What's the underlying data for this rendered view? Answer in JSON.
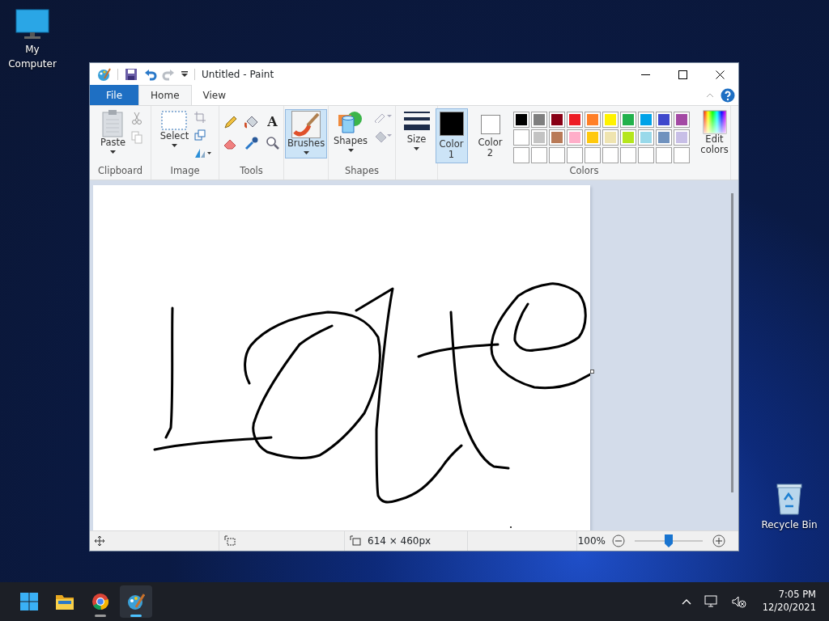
{
  "desktop_icons": [
    {
      "label": "My Computer",
      "kind": "computer"
    },
    {
      "label": "Recycle Bin",
      "kind": "bin"
    }
  ],
  "window": {
    "title": "Untitled - Paint"
  },
  "ribbon_tabs": [
    {
      "label": "File",
      "kind": "file",
      "selected": false
    },
    {
      "label": "Home",
      "kind": "tab",
      "selected": true
    },
    {
      "label": "View",
      "kind": "tab",
      "selected": false
    }
  ],
  "clipboard": {
    "paste": "Paste",
    "group_label": "Clipboard"
  },
  "image": {
    "select": "Select",
    "group_label": "Image"
  },
  "tools": {
    "group_label": "Tools",
    "text_tool": "A"
  },
  "brushes": {
    "label": "Brushes",
    "selected": true
  },
  "shapes": {
    "label": "Shapes",
    "group_label": "Shapes"
  },
  "size": {
    "label": "Size"
  },
  "colors": {
    "slots": [
      {
        "label": "Color 1",
        "color": "#000000",
        "selected": true
      },
      {
        "label": "Color 2",
        "color": "#ffffff",
        "selected": false
      }
    ],
    "palette": [
      {
        "color": "#000000"
      },
      {
        "color": "#7f7f7f"
      },
      {
        "color": "#880015"
      },
      {
        "color": "#ed1c24"
      },
      {
        "color": "#ff7f27"
      },
      {
        "color": "#fff200"
      },
      {
        "color": "#22b14c"
      },
      {
        "color": "#00a2e8"
      },
      {
        "color": "#3f48cc"
      },
      {
        "color": "#a349a4"
      },
      {
        "color": "#ffffff"
      },
      {
        "color": "#c3c3c3"
      },
      {
        "color": "#b97a57"
      },
      {
        "color": "#ffaec9"
      },
      {
        "color": "#ffc90e"
      },
      {
        "color": "#efe4b0"
      },
      {
        "color": "#b5e61d"
      },
      {
        "color": "#99d9ea"
      },
      {
        "color": "#7092be"
      },
      {
        "color": "#c8bfe7"
      }
    ],
    "edit": "Edit colors",
    "group_label": "Colors"
  },
  "status_bar": {
    "image_size": "614 × 460px",
    "zoom": "100%",
    "zoom_slider": {
      "level": 0.5
    }
  },
  "taskbar": {
    "apps": [
      {
        "kind": "start",
        "running": false,
        "selected": false
      },
      {
        "kind": "folder",
        "running": false,
        "selected": false
      },
      {
        "kind": "browser",
        "running": true,
        "selected": false
      },
      {
        "kind": "paint",
        "running": true,
        "selected": true
      }
    ],
    "time": "7:05 PM",
    "date": "12/20/2021"
  }
}
